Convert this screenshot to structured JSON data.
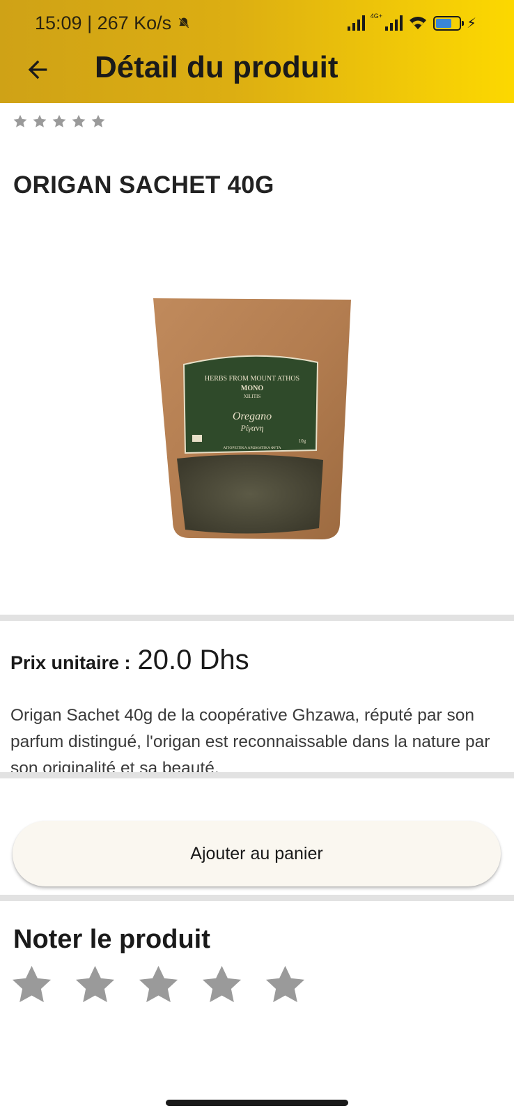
{
  "status_bar": {
    "time_speed": "15:09 | 267 Ko/s",
    "network_tag": "4G+"
  },
  "app_bar": {
    "title": "Détail du produit"
  },
  "product": {
    "name": "ORIGAN SACHET 40G",
    "current_rating": 0,
    "max_rating": 5,
    "price_label": "Prix unitaire :",
    "price_value": "20.0 Dhs",
    "description": "Origan Sachet 40g de la coopérative Ghzawa, réputé par son parfum distingué, l'origan est reconnaissable dans la nature par son originalité et sa beauté.",
    "package": {
      "brand_top": "HERBS FROM MOUNT ATHOS",
      "brand_logo_line1": "MONO",
      "brand_logo_line2": "XILITIS",
      "product_en": "Oregano",
      "product_gr": "Ρίγανη",
      "weight": "10g",
      "footer_gr": "ΑΓΙΟΡΕΙΤΙΚΑ ΑΡΩΜΑΤΙΚΑ ΦΥΤΑ"
    }
  },
  "actions": {
    "add_to_cart_label": "Ajouter au panier"
  },
  "rating_section": {
    "title": "Noter le produit",
    "star_count": 5
  },
  "colors": {
    "appbar_start": "#cfa216",
    "appbar_end": "#fcd800",
    "star_gray": "#9a9a9a",
    "button_bg": "#faf7f0",
    "divider": "#e2e2e2"
  },
  "icons": {
    "back": "arrow-left-icon",
    "star": "star-icon",
    "signal": "signal-icon",
    "wifi": "wifi-icon",
    "battery": "battery-charging-icon",
    "mute": "bell-off-icon"
  }
}
